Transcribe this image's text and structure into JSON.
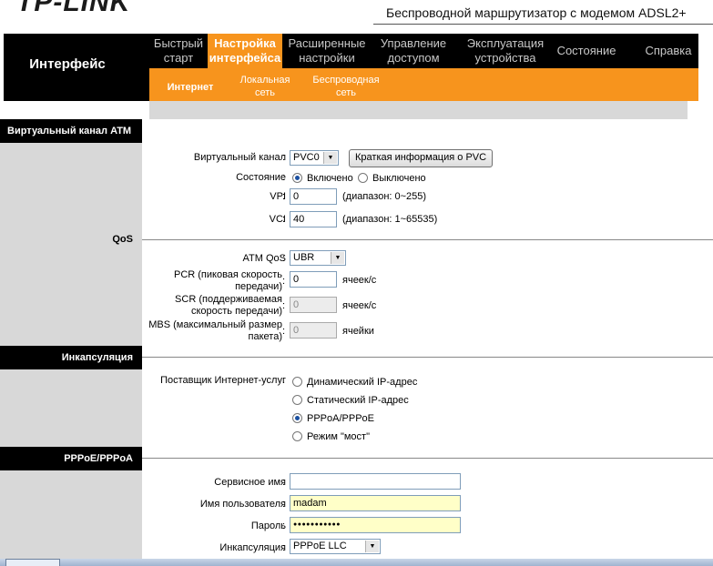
{
  "header": {
    "logo": "TP-LINK",
    "product": "Беспроводной маршрутизатор с модемом ADSL2+"
  },
  "section_title": "Интерфейс",
  "nav": [
    {
      "line1": "Быстрый",
      "line2": "старт"
    },
    {
      "line1": "Настройка",
      "line2": "интерфейса"
    },
    {
      "line1": "Расширенные",
      "line2": "настройки"
    },
    {
      "line1": "Управление",
      "line2": "доступом"
    },
    {
      "line1": "Эксплуатация",
      "line2": "устройства"
    },
    {
      "line1": "Состояние",
      "line2": ""
    },
    {
      "line1": "Справка",
      "line2": ""
    }
  ],
  "subnav": [
    {
      "line1": "Интернет",
      "line2": ""
    },
    {
      "line1": "Локальная",
      "line2": "сеть"
    },
    {
      "line1": "Беспроводная",
      "line2": "сеть"
    }
  ],
  "sections": {
    "atm": "Виртуальный канал ATM",
    "qos": "QoS",
    "encap": "Инкапсуляция",
    "pppoe": "PPPoE/PPPoA"
  },
  "atm": {
    "vc_label": "Виртуальный канал",
    "vc_value": "PVC0",
    "pvc_button": "Краткая информация о PVC",
    "state_label": "Состояние",
    "state_on": "Включено",
    "state_off": "Выключено",
    "vpi_label": "VPI",
    "vpi_value": "0",
    "vpi_hint": "(диапазон: 0~255)",
    "vci_label": "VCI",
    "vci_value": "40",
    "vci_hint": "(диапазон: 1~65535)"
  },
  "qos": {
    "atm_qos_label": "ATM QoS",
    "atm_qos_value": "UBR",
    "pcr_label1": "PCR (пиковая скорость",
    "pcr_label2": "передачи)",
    "pcr_value": "0",
    "pcr_unit": "ячеек/с",
    "scr_label1": "SCR (поддерживаемая",
    "scr_label2": "скорость передачи)",
    "scr_value": "0",
    "scr_unit": "ячеек/с",
    "mbs_label1": "MBS (максимальный размер",
    "mbs_label2": "пакета)",
    "mbs_value": "0",
    "mbs_unit": "ячейки"
  },
  "encap": {
    "isp_label": "Поставщик Интернет-услуг",
    "options": [
      "Динамический IP-адрес",
      "Статический IP-адрес",
      "PPPoA/PPPoE",
      "Режим \"мост\""
    ],
    "selected": "PPPoA/PPPoE"
  },
  "pppoe": {
    "service_label": "Сервисное имя",
    "service_value": "",
    "user_label": "Имя пользователя",
    "user_value": "madam",
    "pass_label": "Пароль",
    "pass_value": "●●●●●●●●●●●",
    "encap_label": "Инкапсуляция",
    "encap_value": "PPPoE LLC"
  },
  "colon": ":"
}
